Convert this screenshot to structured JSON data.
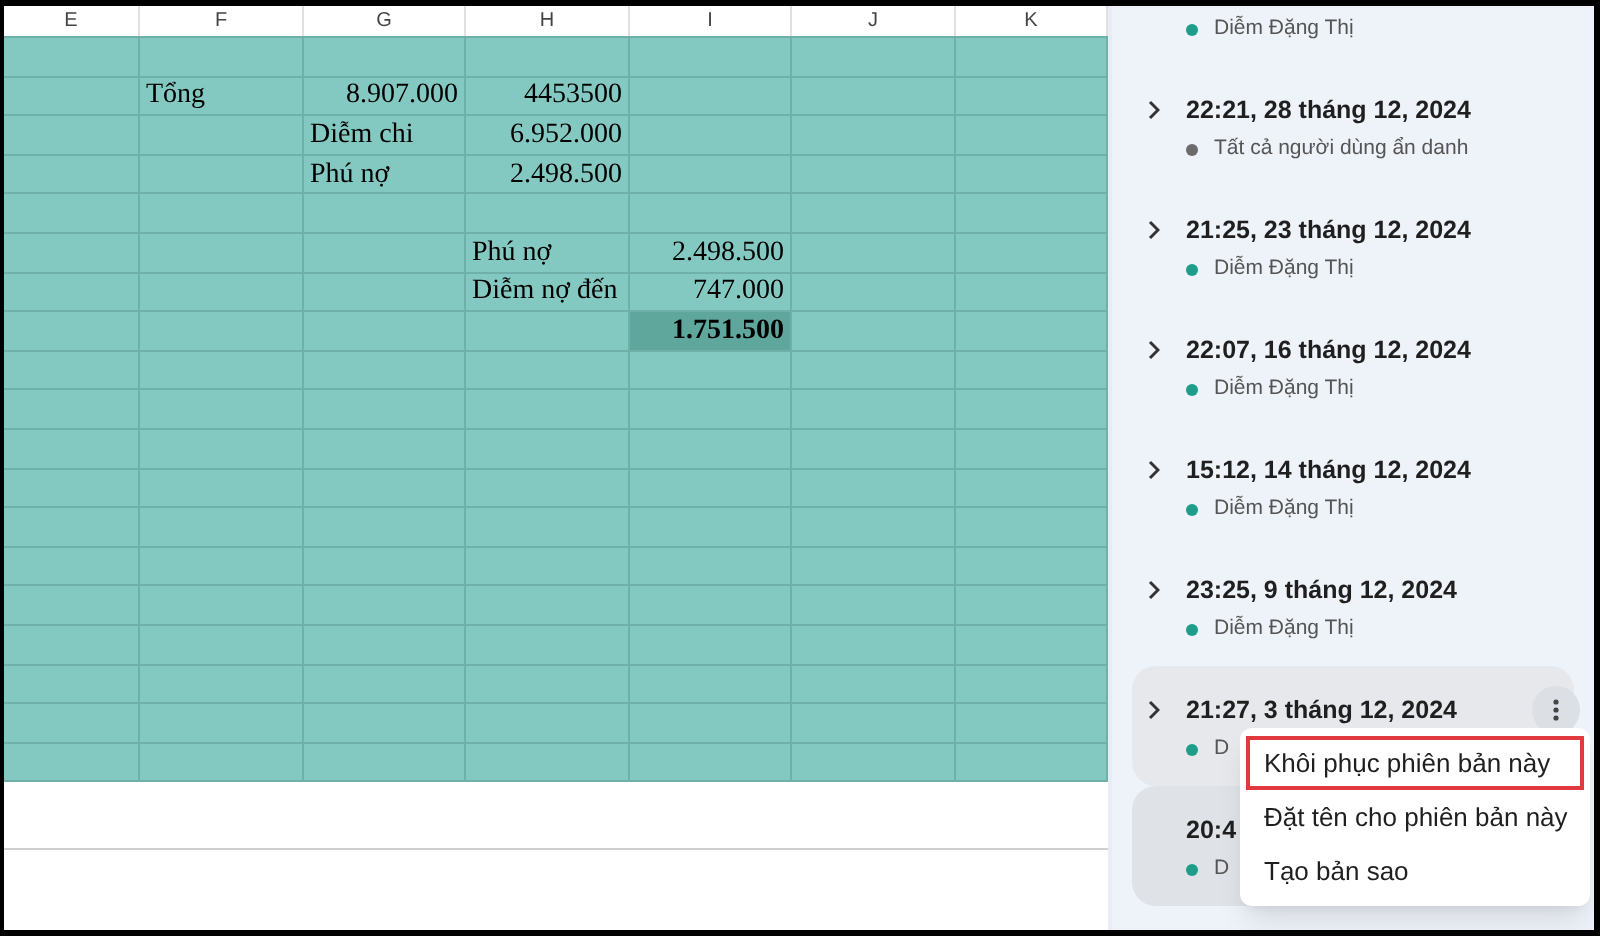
{
  "sheet": {
    "columns": [
      "E",
      "F",
      "G",
      "H",
      "I",
      "J",
      "K"
    ],
    "rows": [
      {},
      {
        "F": {
          "text": "Tổng",
          "kind": "text",
          "selected": false
        },
        "G": {
          "text": "8.907.000",
          "kind": "number",
          "selected": false
        },
        "H": {
          "text": "4453500",
          "kind": "number",
          "selected": false
        }
      },
      {
        "G": {
          "text": "Diễm chi",
          "kind": "text",
          "selected": false
        },
        "H": {
          "text": "6.952.000",
          "kind": "number",
          "selected": false
        }
      },
      {
        "G": {
          "text": "Phú nợ",
          "kind": "text",
          "selected": false
        },
        "H": {
          "text": "2.498.500",
          "kind": "number",
          "selected": false
        }
      },
      {},
      {
        "H": {
          "text": "Phú nợ",
          "kind": "text",
          "selected": false
        },
        "I": {
          "text": "2.498.500",
          "kind": "number",
          "selected": false
        }
      },
      {
        "H": {
          "text": "Diễm nợ đến",
          "kind": "text",
          "selected": false
        },
        "I": {
          "text": "747.000",
          "kind": "number",
          "selected": false
        }
      },
      {
        "I": {
          "text": "1.751.500",
          "kind": "number",
          "selected": true
        }
      },
      {},
      {},
      {},
      {},
      {},
      {},
      {},
      {},
      {},
      {},
      {}
    ]
  },
  "versions": [
    {
      "author": "Diễm Đặng Thị",
      "color": "#1e9e8a",
      "hovered": false,
      "selected": false
    },
    {
      "title": "22:21, 28 tháng 12, 2024",
      "author": "Tất cả người dùng ẩn danh",
      "color": "#6b6b6b",
      "hovered": false,
      "selected": false
    },
    {
      "title": "21:25, 23 tháng 12, 2024",
      "author": "Diễm Đặng Thị",
      "color": "#1e9e8a",
      "hovered": false,
      "selected": false
    },
    {
      "title": "22:07, 16 tháng 12, 2024",
      "author": "Diễm Đặng Thị",
      "color": "#1e9e8a",
      "hovered": false,
      "selected": false
    },
    {
      "title": "15:12, 14 tháng 12, 2024",
      "author": "Diễm Đặng Thị",
      "color": "#1e9e8a",
      "hovered": false,
      "selected": false
    },
    {
      "title": "23:25, 9 tháng 12, 2024",
      "author": "Diễm Đặng Thị",
      "color": "#1e9e8a",
      "hovered": false,
      "selected": false
    },
    {
      "title": "21:27, 3 tháng 12, 2024",
      "author": "D",
      "color": "#1e9e8a",
      "hovered": true,
      "selected": false,
      "menu_open": true
    },
    {
      "title": "20:4",
      "author": "D",
      "color": "#1e9e8a",
      "hovered": false,
      "selected": true
    }
  ],
  "context_menu": {
    "items": [
      {
        "label": "Khôi phục phiên bản này",
        "highlighted": true
      },
      {
        "label": "Đặt tên cho phiên bản này",
        "highlighted": false
      },
      {
        "label": "Tạo bản sao",
        "highlighted": false
      }
    ]
  }
}
